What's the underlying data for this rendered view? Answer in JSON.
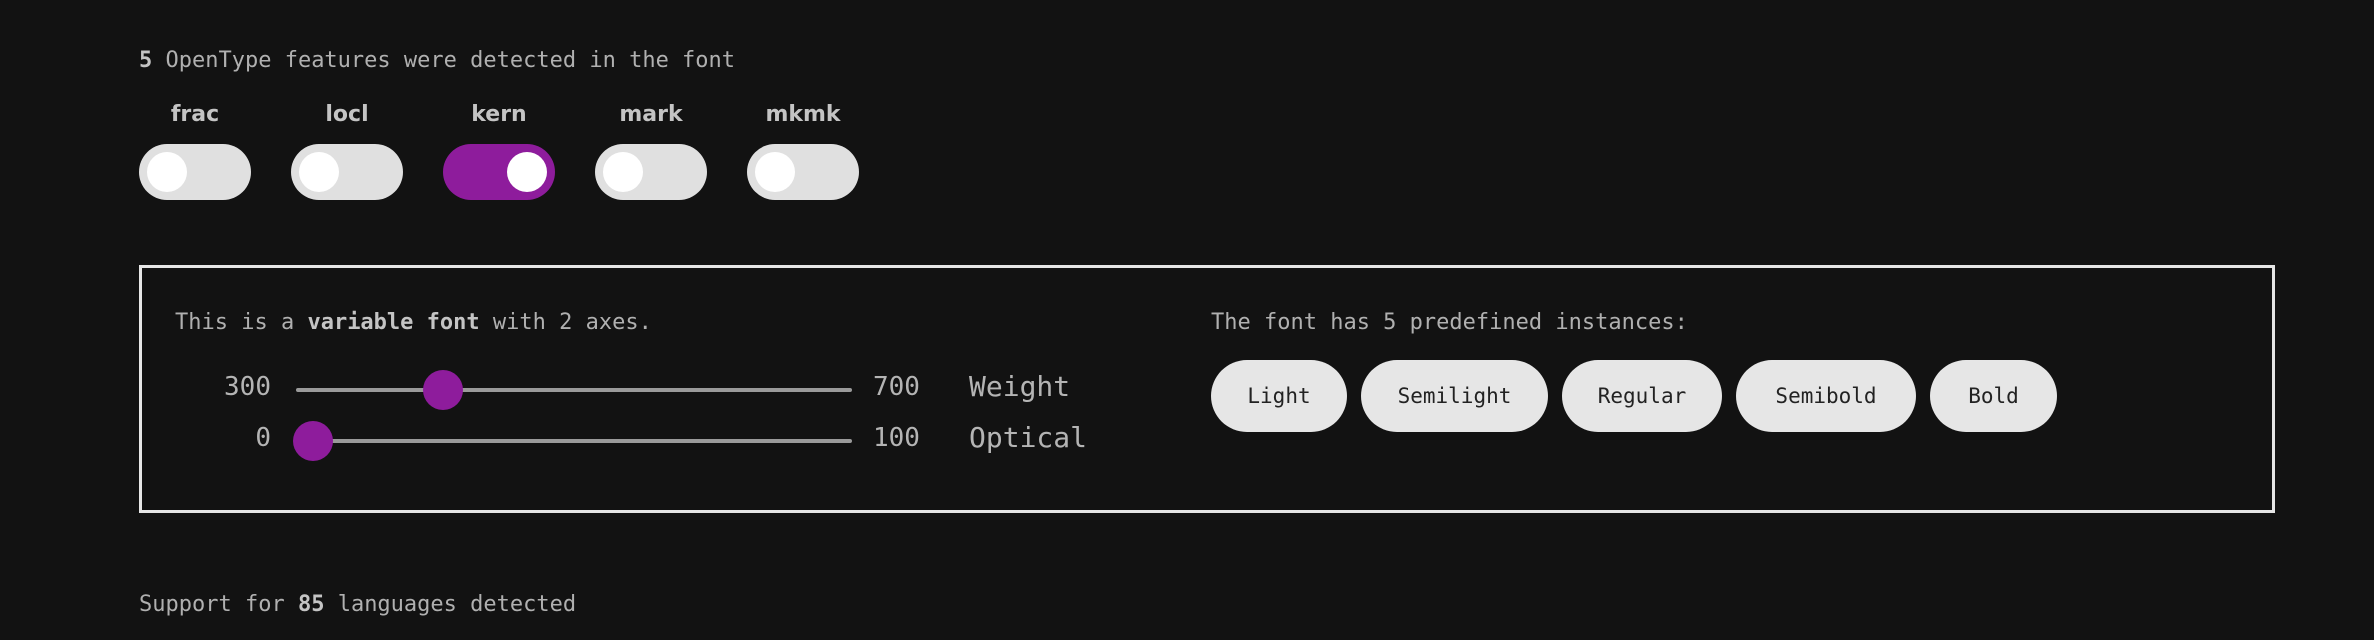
{
  "features": {
    "count": "5",
    "count_suffix": " OpenType features were detected in the font",
    "items": [
      {
        "label": "frac",
        "on": false
      },
      {
        "label": "locl",
        "on": false
      },
      {
        "label": "kern",
        "on": true
      },
      {
        "label": "mark",
        "on": false
      },
      {
        "label": "mkmk",
        "on": false
      }
    ]
  },
  "variable": {
    "intro_prefix": "This is a ",
    "intro_bold": "variable font",
    "intro_suffix": " with 2 axes.",
    "axes": [
      {
        "name": "Weight",
        "min": "300",
        "max": "700",
        "value_fraction": 0.265
      },
      {
        "name": "Optical",
        "min": "0",
        "max": "100",
        "value_fraction": 0.03
      }
    ],
    "instances_text": "The font has 5 predefined instances:",
    "instances": [
      "Light",
      "Semilight",
      "Regular",
      "Semibold",
      "Bold"
    ]
  },
  "languages": {
    "prefix": "Support for ",
    "count": "85",
    "suffix": " languages detected"
  },
  "colors": {
    "accent": "#8e1c9c",
    "background": "#121212",
    "toggle_off": "#e0e0e0"
  }
}
